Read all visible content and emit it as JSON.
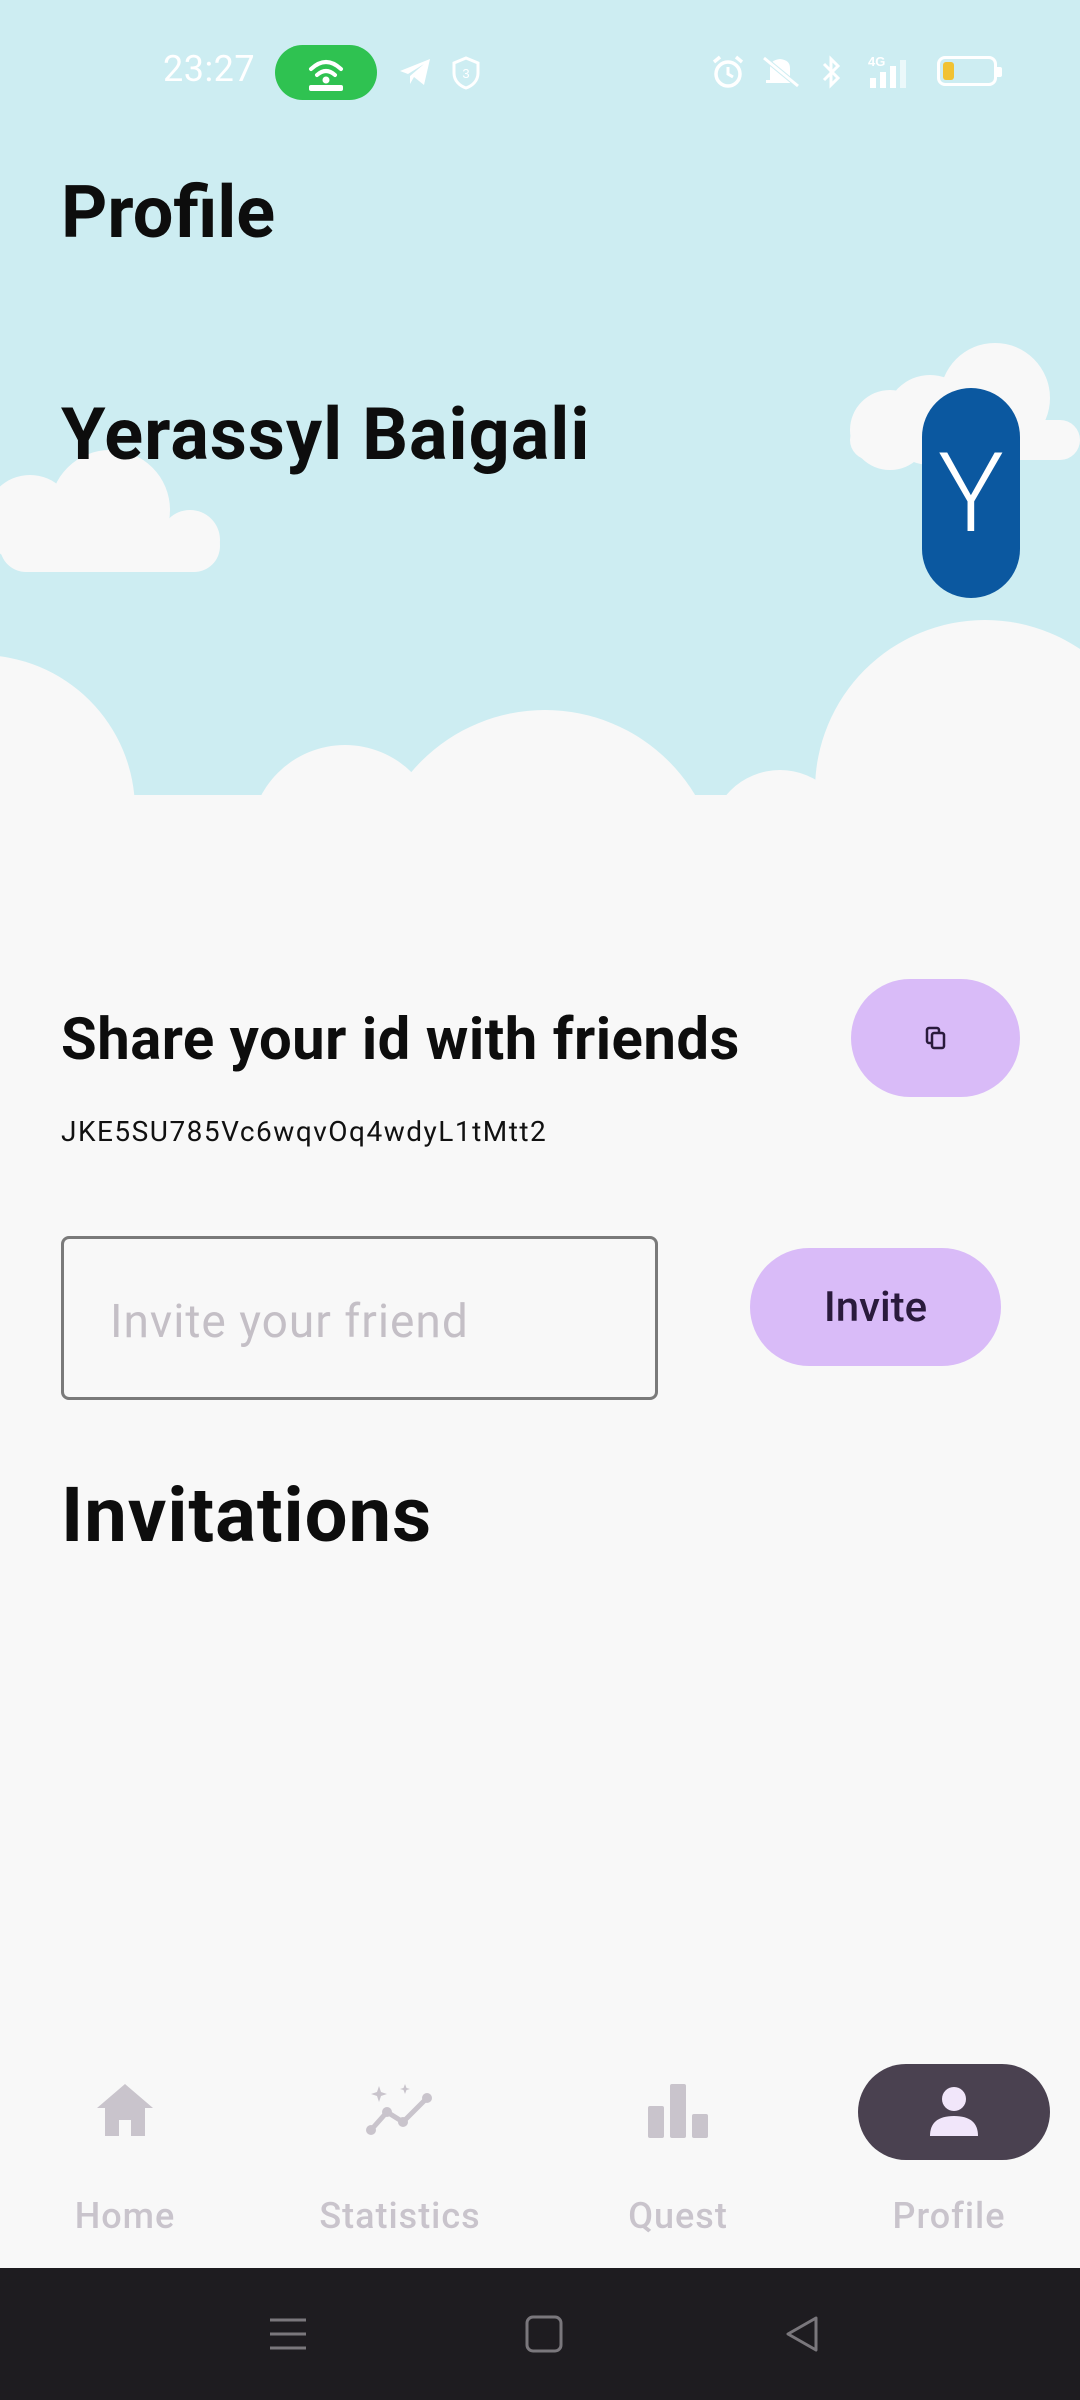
{
  "status_bar": {
    "time": "23:27",
    "icons": [
      "wifi-hotspot-icon",
      "telegram-icon",
      "shield-badge-icon",
      "alarm-icon",
      "mute-icon",
      "bluetooth-icon",
      "signal-4g-icon",
      "battery-icon"
    ],
    "hotspot_color": "#2fc251",
    "battery_level_color": "#f1c232"
  },
  "header": {
    "title": "Profile",
    "user_name": "Yerassyl Baigali",
    "avatar_letter": "Y",
    "avatar_color": "#0b58a0",
    "sky_color": "#cdedf2"
  },
  "share": {
    "title": "Share your id with friends",
    "id": "JKE5SU785Vc6wqvOq4wdyL1tMtt2",
    "copy_icon": "copy-icon"
  },
  "invite": {
    "placeholder": "Invite your friend",
    "button_label": "Invite",
    "button_color": "#d9bbf8"
  },
  "invitations": {
    "title": "Invitations"
  },
  "bottom_nav": {
    "items": [
      {
        "label": "Home",
        "icon": "home-icon"
      },
      {
        "label": "Statistics",
        "icon": "statistics-icon"
      },
      {
        "label": "Quest",
        "icon": "bar-chart-icon"
      },
      {
        "label": "Profile",
        "icon": "person-icon",
        "active": true
      }
    ],
    "active_pill_color": "#4a4150"
  },
  "system_nav": {
    "icons": [
      "menu-icon",
      "home-square-icon",
      "back-triangle-icon"
    ]
  }
}
